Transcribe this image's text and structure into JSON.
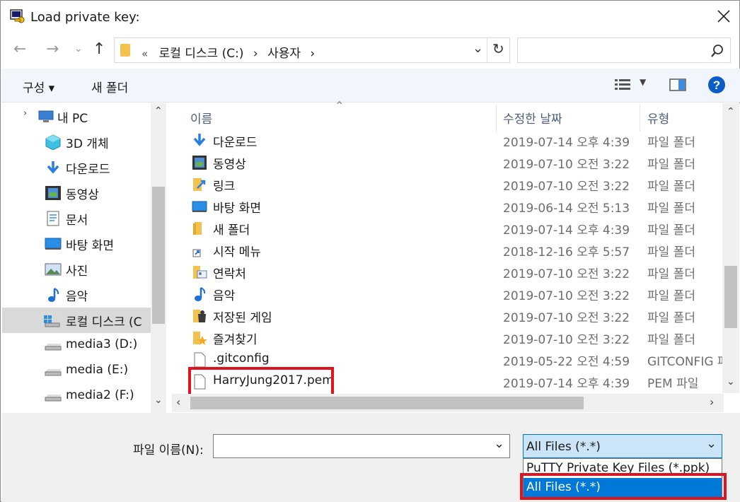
{
  "window": {
    "title": "Load private key:"
  },
  "address": {
    "crumbs": [
      "«",
      "로컬 디스크 (C:)",
      "›",
      "사용자",
      "›"
    ]
  },
  "toolbar": {
    "organize": "구성 ▾",
    "new_folder": "새 폴더"
  },
  "sidebar": {
    "items": [
      {
        "label": "내 PC",
        "icon": "computer-icon"
      },
      {
        "label": "3D 개체",
        "icon": "cube-icon"
      },
      {
        "label": "다운로드",
        "icon": "download-arrow-icon"
      },
      {
        "label": "동영상",
        "icon": "film-icon"
      },
      {
        "label": "문서",
        "icon": "document-icon"
      },
      {
        "label": "바탕 화면",
        "icon": "desktop-icon"
      },
      {
        "label": "사진",
        "icon": "picture-icon"
      },
      {
        "label": "음악",
        "icon": "music-note-icon"
      },
      {
        "label": "로컬 디스크 (C",
        "icon": "windows-drive-icon"
      },
      {
        "label": "media3 (D:)",
        "icon": "drive-icon"
      },
      {
        "label": "media (E:)",
        "icon": "drive-icon"
      },
      {
        "label": "media2 (F:)",
        "icon": "drive-icon"
      }
    ]
  },
  "columns": {
    "name": "이름",
    "date": "수정한 날짜",
    "type": "유형"
  },
  "files": [
    {
      "name": "다운로드",
      "date": "2019-07-14 오후 4:39",
      "type": "파일 폴더",
      "icon": "download-folder-icon"
    },
    {
      "name": "동영상",
      "date": "2019-07-10 오전 3:22",
      "type": "파일 폴더",
      "icon": "video-folder-icon"
    },
    {
      "name": "링크",
      "date": "2019-07-10 오전 3:22",
      "type": "파일 폴더",
      "icon": "links-folder-icon"
    },
    {
      "name": "바탕 화면",
      "date": "2019-06-14 오전 5:13",
      "type": "파일 폴더",
      "icon": "desktop-folder-icon"
    },
    {
      "name": "새 폴더",
      "date": "2019-07-14 오후 4:39",
      "type": "파일 폴더",
      "icon": "folder-icon"
    },
    {
      "name": "시작 메뉴",
      "date": "2018-12-16 오후 5:57",
      "type": "파일 폴더",
      "icon": "shortcut-icon"
    },
    {
      "name": "연락처",
      "date": "2019-07-10 오전 3:22",
      "type": "파일 폴더",
      "icon": "contacts-folder-icon"
    },
    {
      "name": "음악",
      "date": "2019-07-10 오전 3:22",
      "type": "파일 폴더",
      "icon": "music-folder-icon"
    },
    {
      "name": "저장된 게임",
      "date": "2019-07-10 오전 3:22",
      "type": "파일 폴더",
      "icon": "saved-games-folder-icon"
    },
    {
      "name": "즐겨찾기",
      "date": "2019-07-10 오전 3:22",
      "type": "파일 폴더",
      "icon": "favorites-folder-icon"
    },
    {
      "name": ".gitconfig",
      "date": "2019-05-22 오전 4:59",
      "type": "GITCONFIG 파",
      "icon": "file-icon"
    },
    {
      "name": "HarryJung2017.pem",
      "date": "2019-07-14 오후 4:39",
      "type": "PEM 파일",
      "icon": "file-icon"
    }
  ],
  "filename": {
    "label": "파일 이름(N):",
    "value": ""
  },
  "filetype": {
    "selected": "All Files (*.*)",
    "options": [
      "PuTTY Private Key Files (*.ppk)",
      "All Files (*.*)"
    ]
  },
  "colors": {
    "accent": "#0078d7",
    "highlight_box": "#e0141e",
    "toolbar_bg": "#f0f6fb"
  }
}
